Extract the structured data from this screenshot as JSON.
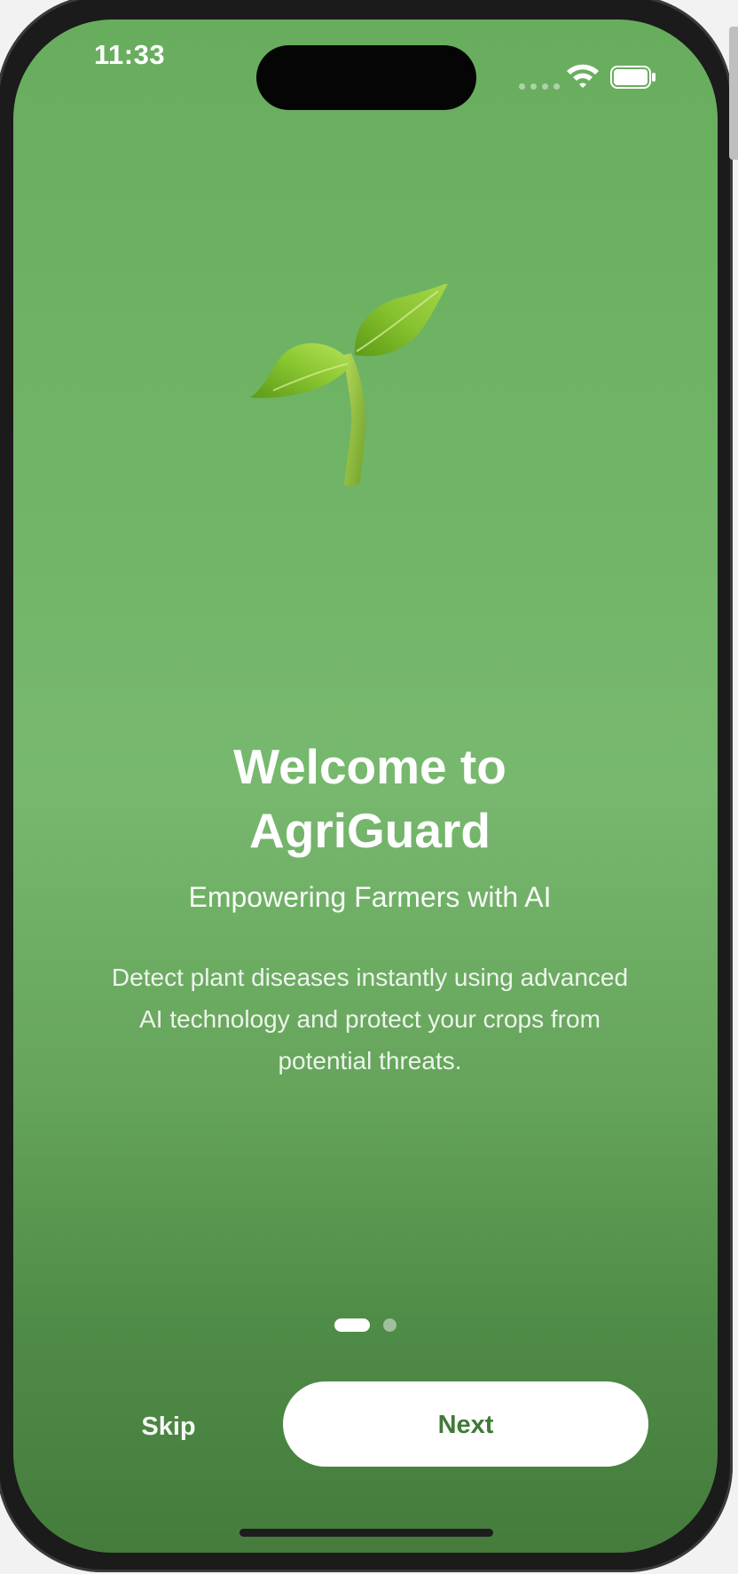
{
  "status_bar": {
    "time": "11:33",
    "icons": [
      "cellular-signal-icon",
      "wifi-icon",
      "battery-icon"
    ]
  },
  "hero": {
    "icon": "seedling-icon"
  },
  "onboarding": {
    "title": "Welcome to\nAgriGuard",
    "subtitle": "Empowering Farmers with AI",
    "description": "Detect plant diseases instantly using advanced AI technology and protect your crops from potential threats.",
    "page_index": 1,
    "page_count": 2
  },
  "actions": {
    "skip_label": "Skip",
    "next_label": "Next"
  },
  "colors": {
    "background_top": "#68ad5e",
    "background_bottom": "#457c3c",
    "next_text": "#3f7a38",
    "button_fill": "#ffffff"
  }
}
